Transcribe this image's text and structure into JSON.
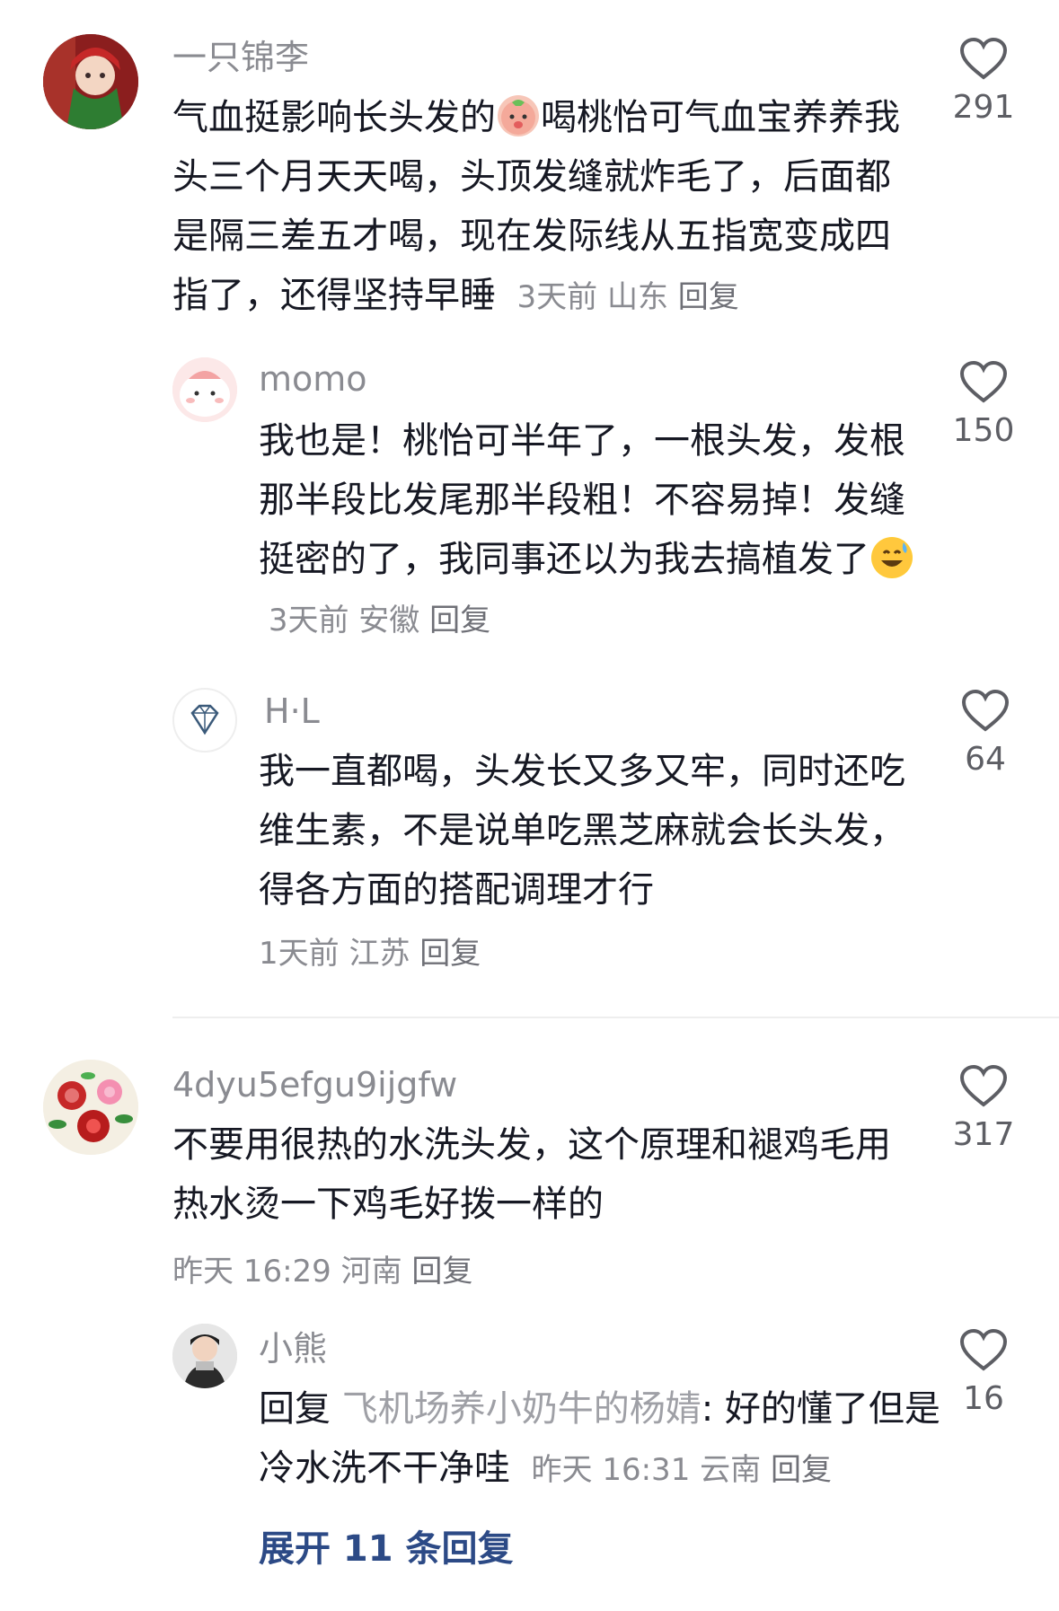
{
  "comments": [
    {
      "user": "一只锦李",
      "text_before_emoji": "气血挺影响长头发的",
      "emoji": "peach-mascot-emoji",
      "text_after_emoji": "喝桃怡可气血宝养养我头三个月天天喝，头顶发缝就炸毛了，后面都是隔三差五才喝，现在发际线从五指宽变成四指了，还得坚持早睡",
      "time": "3天前",
      "location": "山东",
      "reply_label": "回复",
      "likes": "291",
      "avatar_icon": "girl-red-hood-avatar"
    },
    {
      "user": "momo",
      "text_before_emoji": "我也是！桃怡可半年了，一根头发，发根那半段比发尾那半段粗！不容易掉！发缝挺密的了，我同事还以为我去搞植发了",
      "emoji": "grinning-sweat-emoji",
      "time": "3天前",
      "location": "安徽",
      "reply_label": "回复",
      "likes": "150",
      "avatar_icon": "pink-cartoon-avatar"
    },
    {
      "user": "H·L",
      "text": "我一直都喝，头发长又多又牢，同时还吃维生素，不是说单吃黑芝麻就会长头发，得各方面的搭配调理才行",
      "time": "1天前",
      "location": "江苏",
      "reply_label": "回复",
      "likes": "64",
      "avatar_icon": "diamond-avatar"
    },
    {
      "user": "4dyu5efgu9ijgfw",
      "text": "不要用很热的水洗头发，这个原理和褪鸡毛用热水烫一下鸡毛好拨一样的",
      "time": "昨天 16:29",
      "location": "河南",
      "reply_label": "回复",
      "likes": "317",
      "avatar_icon": "peony-flowers-avatar"
    },
    {
      "user": "小熊",
      "reply_prefix": "回复",
      "mention": "飞机场养小奶牛的杨婧",
      "text": ": 好的懂了但是冷水洗不干净哇",
      "time": "昨天 16:31",
      "location": "云南",
      "reply_label": "回复",
      "likes": "16",
      "avatar_icon": "person-scarf-avatar"
    }
  ],
  "expand_replies": "展开 11 条回复",
  "colors": {
    "text": "#161823",
    "meta": "#8a8b91",
    "link": "#2c4a86",
    "divider": "#eeeeee"
  }
}
